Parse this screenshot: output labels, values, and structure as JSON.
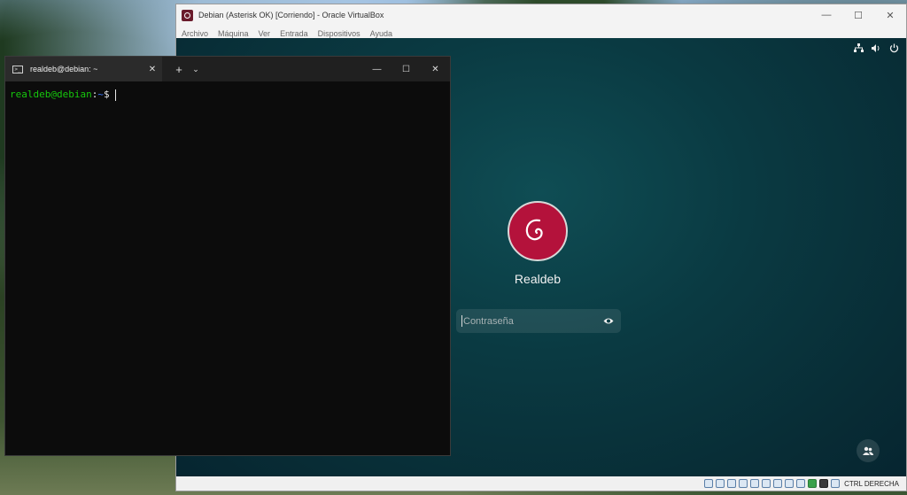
{
  "vbox": {
    "title": "Debian (Asterisk OK) [Corriendo] - Oracle VirtualBox",
    "menu": [
      "Archivo",
      "Máquina",
      "Ver",
      "Entrada",
      "Dispositivos",
      "Ayuda"
    ],
    "host_key": "CTRL DERECHA"
  },
  "login": {
    "user_name": "Realdeb",
    "password_placeholder": "Contraseña"
  },
  "terminal": {
    "tab_title": "realdeb@debian: ~",
    "prompt_user": "realdeb@debian",
    "prompt_sep": ":",
    "prompt_path": "~",
    "prompt_symbol": "$"
  },
  "icons": {
    "network": "network-icon",
    "volume": "volume-icon",
    "power": "power-icon",
    "eye": "show-password-icon",
    "accessibility": "users-icon"
  }
}
